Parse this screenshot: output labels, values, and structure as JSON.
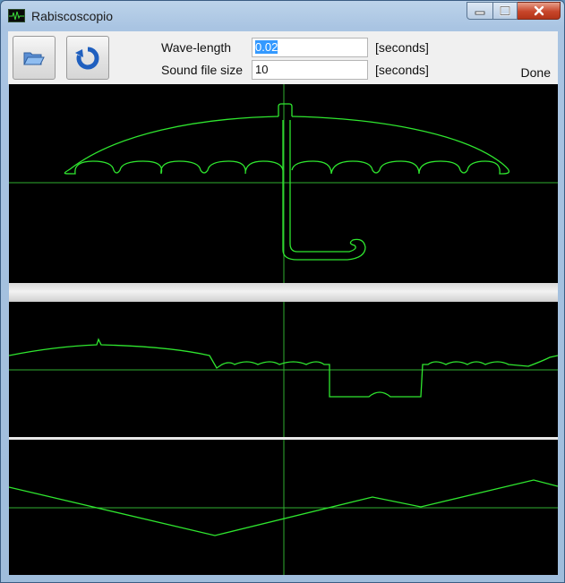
{
  "window": {
    "title": "Rabiscoscopio"
  },
  "toolbar": {
    "open_icon": "folder-open-icon",
    "refresh_icon": "refresh-icon",
    "wavelength": {
      "label": "Wave-length",
      "value": "0.02",
      "unit": "[seconds]"
    },
    "sound_file_size": {
      "label": "Sound file size",
      "value": "10",
      "unit": "[seconds]"
    },
    "status": "Done"
  },
  "colors": {
    "trace": "#2fe62f",
    "axis": "#2fae2f",
    "background": "#000000"
  }
}
